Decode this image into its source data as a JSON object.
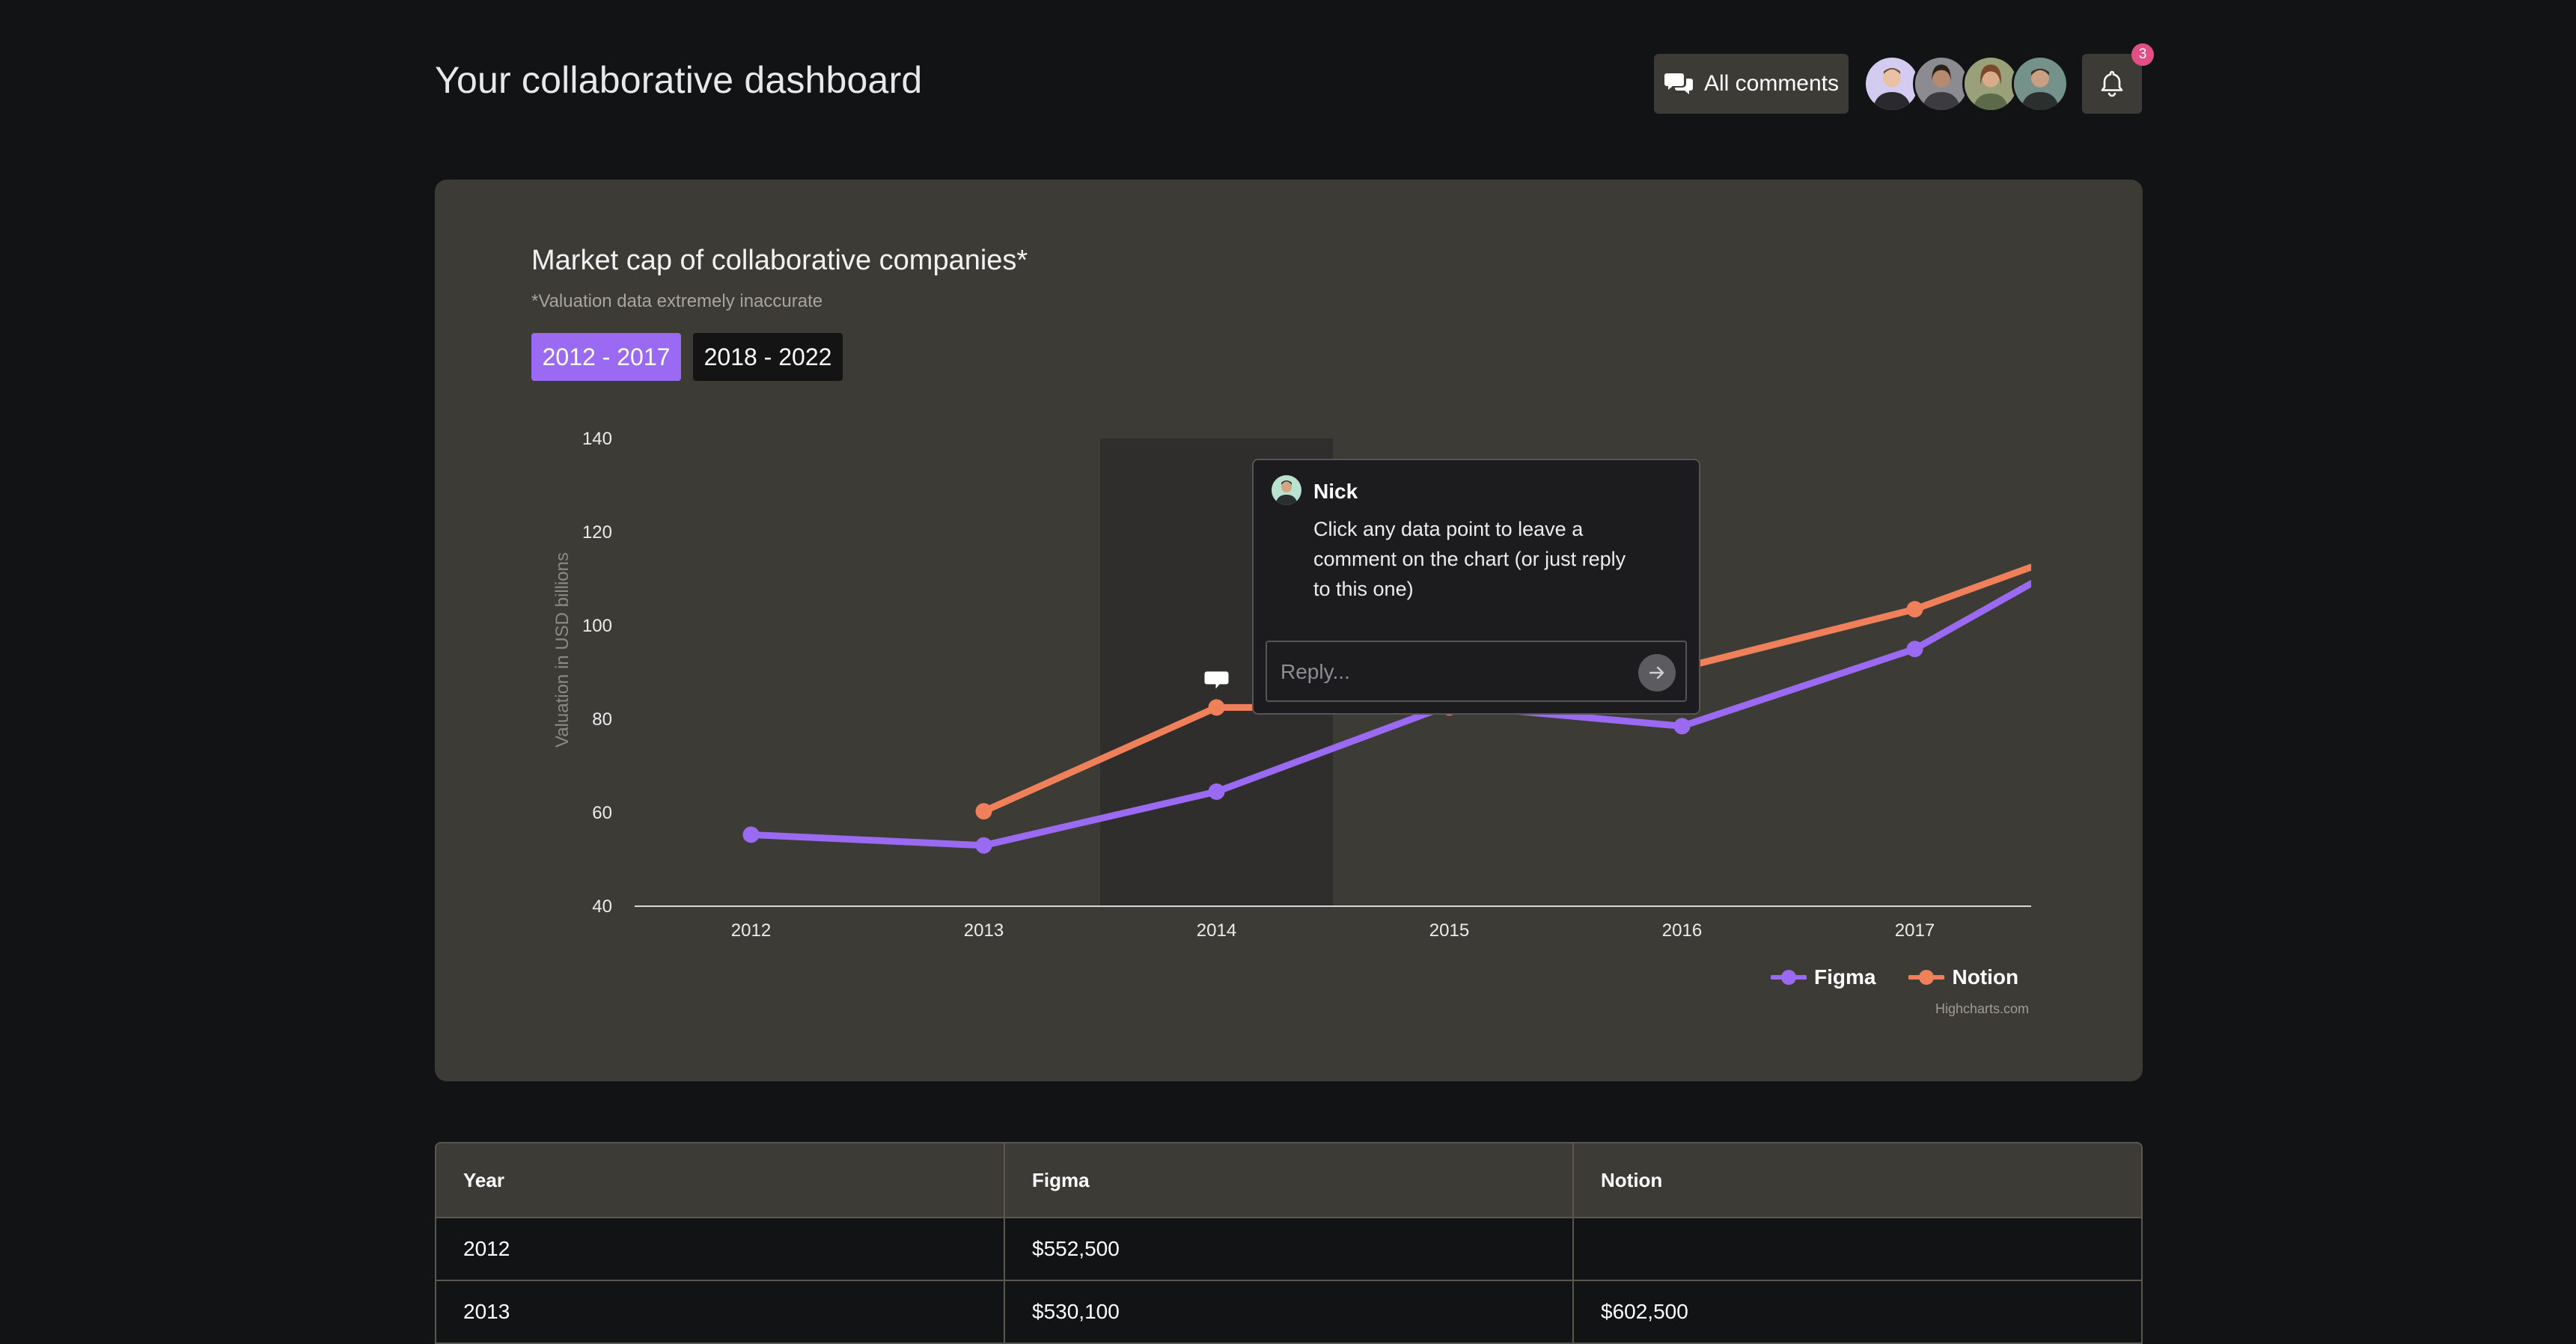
{
  "header": {
    "title": "Your collaborative dashboard",
    "all_comments_label": "All comments",
    "notification_count": "3",
    "avatars": [
      "avatar-1",
      "avatar-2",
      "avatar-3",
      "avatar-4"
    ]
  },
  "chart_card": {
    "range_buttons": [
      "2012 - 2017",
      "2018 - 2022"
    ],
    "active_range": "2012 - 2017",
    "credits": "Highcharts.com"
  },
  "chart_data": {
    "type": "line",
    "title": "Market cap of collaborative companies*",
    "subtitle": "*Valuation data extremely inaccurate",
    "xlabel": "",
    "ylabel": "Valuation in USD billions",
    "categories": [
      "2012",
      "2013",
      "2014",
      "2015",
      "2016",
      "2017"
    ],
    "x_extends_past_last": 0.5,
    "yticks": [
      40,
      60,
      80,
      100,
      120,
      140
    ],
    "ylim": [
      40,
      140
    ],
    "highlighted_category": "2014",
    "comment_marker_on": {
      "series": "Notion",
      "category": "2014"
    },
    "grid": false,
    "legend_position": "bottom-right",
    "series": [
      {
        "name": "Figma",
        "color": "#9a6bf2",
        "values": [
          55.3,
          53.0,
          64.5,
          83.0,
          78.5,
          95.0
        ],
        "end_value": 109
      },
      {
        "name": "Notion",
        "color": "#f0805a",
        "values": [
          null,
          60.3,
          82.5,
          82.5,
          91.0,
          103.5
        ],
        "end_value": 112.5
      }
    ]
  },
  "comment": {
    "author": "Nick",
    "text": "Click any data point to leave a comment on the chart (or just reply to this one)",
    "reply_placeholder": "Reply..."
  },
  "table": {
    "headers": [
      "Year",
      "Figma",
      "Notion"
    ],
    "rows": [
      [
        "2012",
        "$552,500",
        ""
      ],
      [
        "2013",
        "$530,100",
        "$602,500"
      ]
    ]
  }
}
